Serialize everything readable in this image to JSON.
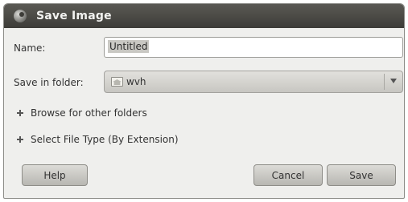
{
  "window": {
    "title": "Save Image",
    "icon": "gimp-icon"
  },
  "name_row": {
    "label": "Name:",
    "value": "Untitled"
  },
  "folder_row": {
    "label": "Save in folder:",
    "value": "wvh",
    "icon": "home-folder-icon"
  },
  "expanders": {
    "browse_label": "Browse for other folders",
    "filetype_label": "Select File Type (By Extension)"
  },
  "buttons": {
    "help": "Help",
    "cancel": "Cancel",
    "save": "Save"
  }
}
